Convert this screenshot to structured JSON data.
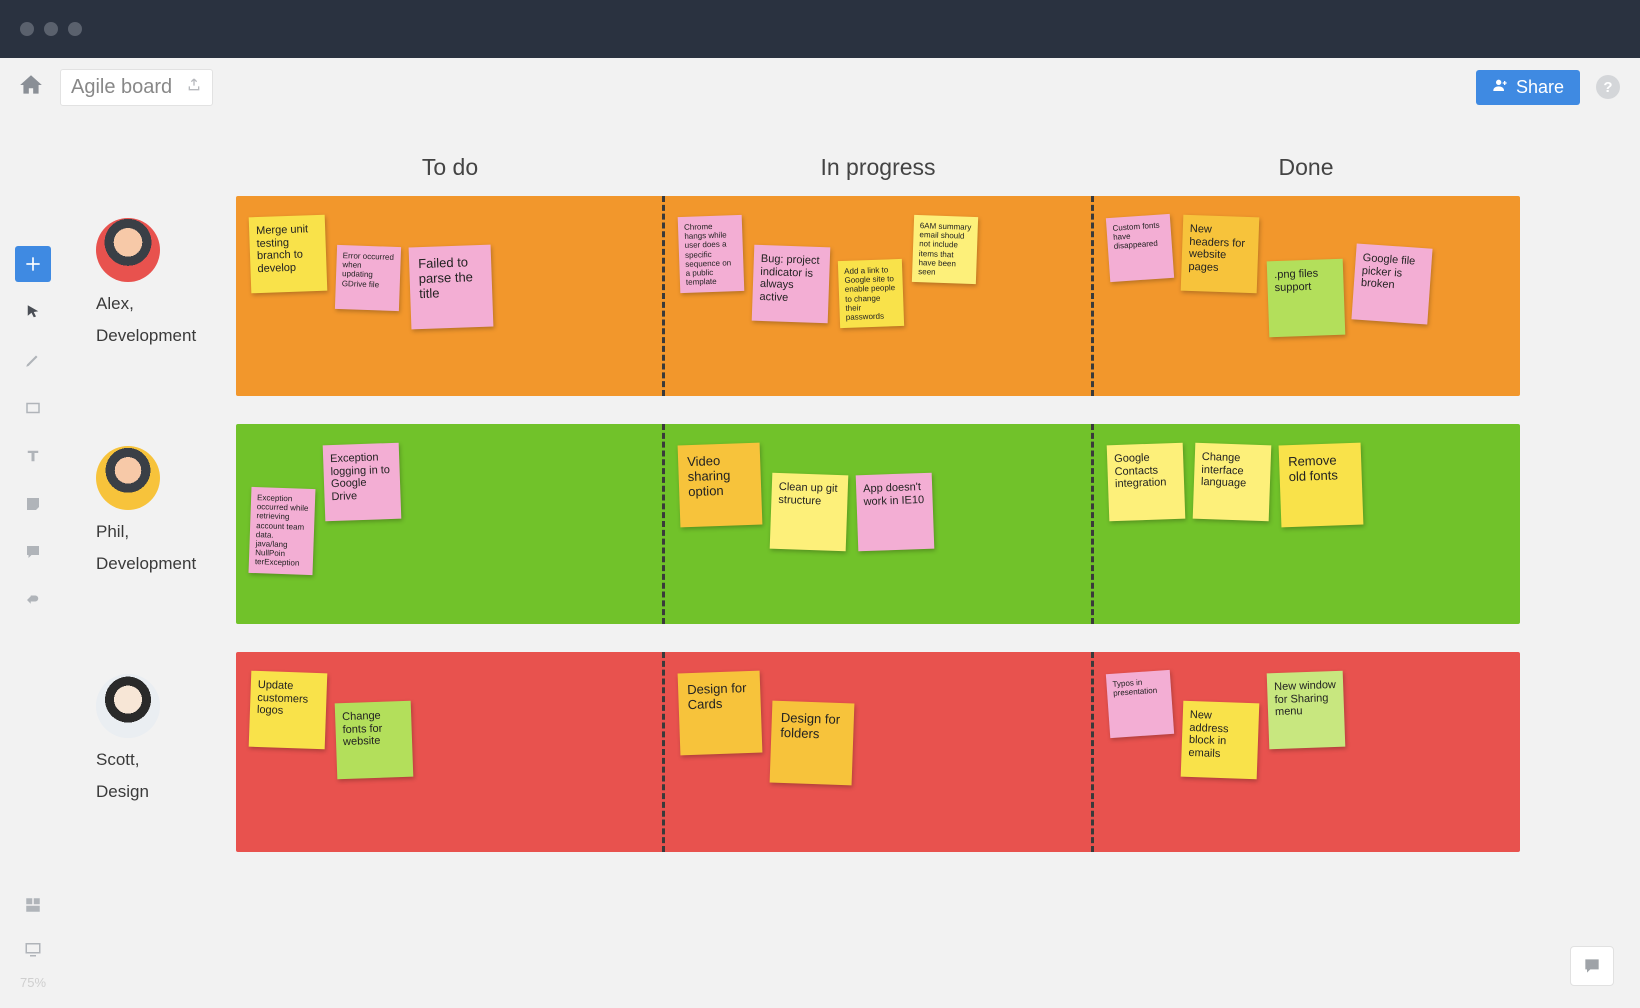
{
  "app": {
    "board_title": "Agile board",
    "share_label": "Share",
    "help_label": "?",
    "zoom_label": "75%"
  },
  "columns": [
    {
      "id": "todo",
      "label": "To do"
    },
    {
      "id": "in_progress",
      "label": "In progress"
    },
    {
      "id": "done",
      "label": "Done"
    }
  ],
  "lanes": [
    {
      "id": "alex",
      "assignee_name": "Alex,",
      "assignee_role": "Development",
      "color": "#f2972c",
      "columns": {
        "todo": [
          {
            "text": "Merge unit testing branch to develop",
            "color": "yellow",
            "size": "med",
            "rot": "l1"
          },
          {
            "text": "Error occurred when updating GDrive file",
            "color": "pink",
            "size": "tiny",
            "rot": "r1",
            "offset": "down"
          },
          {
            "text": "Failed to parse the title",
            "color": "pink",
            "size": "big",
            "rot": "l1",
            "offset": "down"
          }
        ],
        "in_progress": [
          {
            "text": "Chrome hangs while user does a specific sequence on a public template",
            "color": "pink",
            "size": "tiny",
            "rot": "l1"
          },
          {
            "text": "Bug: project indicator is always active",
            "color": "pink",
            "size": "med",
            "rot": "r1",
            "offset": "down"
          },
          {
            "text": "Add a link to Google site to enable people to change their passwords",
            "color": "yellow",
            "size": "tiny",
            "rot": "l1",
            "offset": "down2"
          },
          {
            "text": "6AM summary email should not include items that have been seen",
            "color": "lightyellow",
            "size": "tiny",
            "rot": "r1"
          }
        ],
        "done": [
          {
            "text": "Custom fonts have disappeared",
            "color": "pink",
            "size": "tiny",
            "rot": "l2"
          },
          {
            "text": "New headers for website pages",
            "color": "orange",
            "size": "med",
            "rot": "r1"
          },
          {
            "text": ".png files support",
            "color": "green",
            "size": "med",
            "rot": "l1",
            "offset": "down2"
          },
          {
            "text": "Google file picker is broken",
            "color": "pink",
            "size": "med",
            "rot": "r2",
            "offset": "down"
          }
        ]
      }
    },
    {
      "id": "phil",
      "assignee_name": "Phil,",
      "assignee_role": "Development",
      "color": "#71c22a",
      "columns": {
        "todo": [
          {
            "text": "Exception occurred while retrieving account team data. java/lang NullPoin terException",
            "color": "pink",
            "size": "tiny",
            "rot": "r1",
            "offset": "down2"
          },
          {
            "text": "Exception logging in to Google Drive",
            "color": "pink",
            "size": "med",
            "rot": "l1"
          }
        ],
        "in_progress": [
          {
            "text": "Video sharing option",
            "color": "orange",
            "size": "big",
            "rot": "l1"
          },
          {
            "text": "Clean up git structure",
            "color": "lightyellow",
            "size": "med",
            "rot": "r1",
            "offset": "down"
          },
          {
            "text": "App doesn't work in IE10",
            "color": "pink",
            "size": "med",
            "rot": "l1",
            "offset": "down"
          }
        ],
        "done": [
          {
            "text": "Google Contacts integration",
            "color": "lightyellow",
            "size": "med",
            "rot": "l1"
          },
          {
            "text": "Change interface language",
            "color": "lightyellow",
            "size": "med",
            "rot": "r1"
          },
          {
            "text": "Remove old fonts",
            "color": "yellow",
            "size": "big",
            "rot": "l1"
          }
        ]
      }
    },
    {
      "id": "scott",
      "assignee_name": "Scott,",
      "assignee_role": "Design",
      "color": "#e8524e",
      "columns": {
        "todo": [
          {
            "text": "Update customers logos",
            "color": "yellow",
            "size": "med",
            "rot": "r1"
          },
          {
            "text": "Change fonts for website",
            "color": "green",
            "size": "med",
            "rot": "l1",
            "offset": "down"
          }
        ],
        "in_progress": [
          {
            "text": "Design for Cards",
            "color": "orange",
            "size": "big",
            "rot": "l1"
          },
          {
            "text": "Design for folders",
            "color": "orange",
            "size": "big",
            "rot": "r1",
            "offset": "down"
          }
        ],
        "done": [
          {
            "text": "Typos in presentation",
            "color": "pink",
            "size": "tiny",
            "rot": "l2"
          },
          {
            "text": "New address block in emails",
            "color": "yellow",
            "size": "med",
            "rot": "r1",
            "offset": "down"
          },
          {
            "text": "New window for Sharing menu",
            "color": "lightgreen",
            "size": "med",
            "rot": "l1"
          }
        ]
      }
    }
  ],
  "tools": {
    "add": "plus-icon",
    "pointer": "cursor-icon",
    "pen": "pencil-icon",
    "shape": "rectangle-icon",
    "text": "text-icon",
    "sticky": "sticky-icon",
    "comment": "comment-icon",
    "undo": "undo-icon",
    "frames": "layout-icon",
    "present": "screen-icon"
  }
}
